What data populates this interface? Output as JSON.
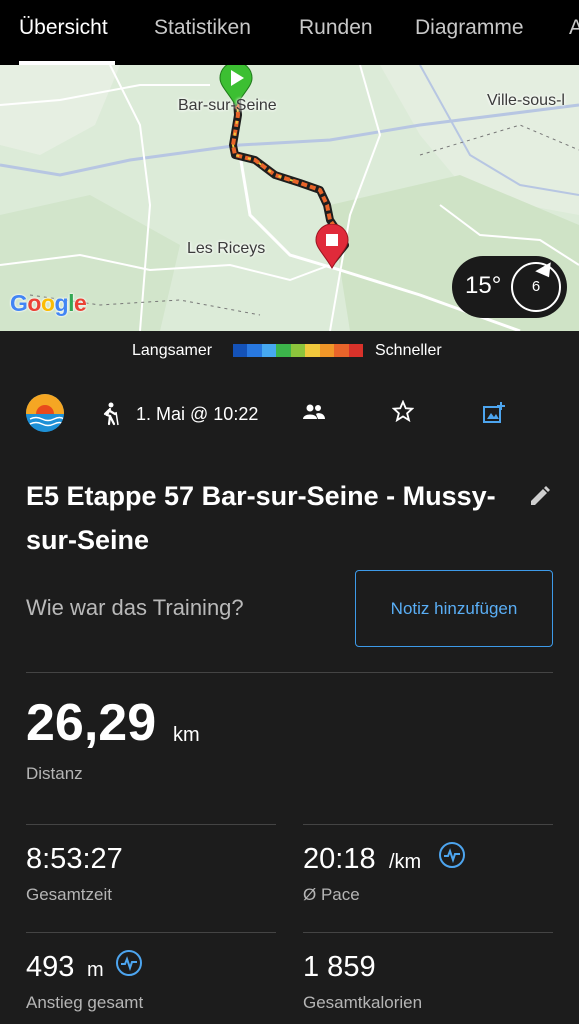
{
  "tabs": [
    {
      "label": "Übersicht",
      "active": true
    },
    {
      "label": "Statistiken",
      "active": false
    },
    {
      "label": "Runden",
      "active": false
    },
    {
      "label": "Diagramme",
      "active": false
    },
    {
      "label": "A",
      "active": false
    }
  ],
  "map": {
    "labels": {
      "start_town": "Bar-sur-Seine",
      "town_right": "Ville-sous-l",
      "town_middle": "Les Riceys"
    },
    "attribution": "Google",
    "weather": {
      "temperature": "15°",
      "wind": "6"
    }
  },
  "legend": {
    "slow_label": "Langsamer",
    "fast_label": "Schneller",
    "colors": [
      "#1452b8",
      "#2878e0",
      "#46a8f0",
      "#3cb44b",
      "#8cc43c",
      "#f0c83c",
      "#f09628",
      "#e8642a",
      "#d8322a"
    ]
  },
  "activity": {
    "icon": "sunset-icon",
    "type_icon": "hiking-icon",
    "date": "1. Mai @ 10:22"
  },
  "title": "E5 Etappe 57 Bar-sur-Seine - Mussy-sur-Seine",
  "note": {
    "question": "Wie war das Training?",
    "button_label": "Notiz hinzufügen"
  },
  "stats": {
    "distance": {
      "value": "26,29",
      "unit": "km",
      "label": "Distanz"
    },
    "total_time": {
      "value": "8:53:27",
      "label": "Gesamtzeit"
    },
    "pace": {
      "value": "20:18",
      "unit": "/km",
      "label": "Ø Pace"
    },
    "ascent": {
      "value": "493",
      "unit": "m",
      "label": "Anstieg gesamt"
    },
    "calories": {
      "value": "1 859",
      "label": "Gesamtkalorien"
    }
  },
  "accent_color": "#4da5ef"
}
